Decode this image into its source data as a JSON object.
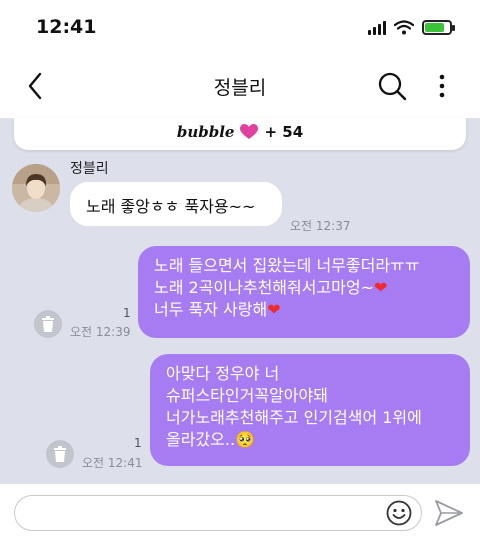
{
  "status": {
    "time": "12:41"
  },
  "header": {
    "title": "정블리"
  },
  "bubble": {
    "brand": "bubble",
    "count": "+ 54"
  },
  "sender": {
    "name": "정블리"
  },
  "messages": {
    "incoming_1": {
      "text": "노래 좋앙ㅎㅎ 푹자용~~",
      "time": "오전 12:37"
    },
    "outgoing_1": {
      "lines": [
        "노래 들으면서 집왔는데 너무좋더라ㅠㅠ",
        "노래 2곡이나추천해줘서고마엉~",
        "너두 푹자 사랑해"
      ],
      "read_count": "1",
      "time": "오전 12:39"
    },
    "outgoing_2": {
      "lines": [
        "아맞다 정우야 너",
        "슈퍼스타인거꼭알아야돼",
        "너가노래추천해주고 인기검색어 1위에",
        "올라갔오..🥺"
      ],
      "read_count": "1",
      "time": "오전 12:41"
    }
  },
  "hearts": {
    "symbol": "❤"
  },
  "input": {
    "placeholder": ""
  },
  "icons": {
    "heart_color": "#e040a0",
    "bubble_color": "#a77cf2",
    "battery_color": "#3cc13b"
  }
}
